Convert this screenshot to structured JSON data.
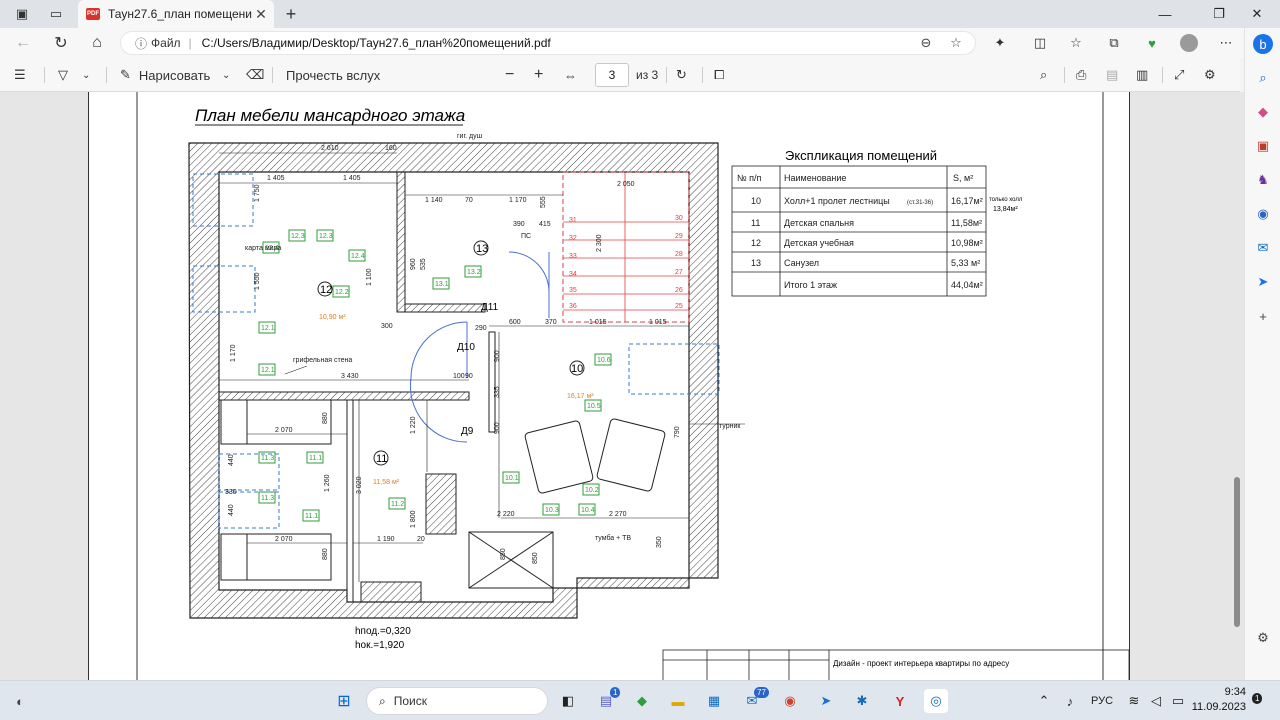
{
  "browser": {
    "tab_title": "Таун27.6_план помещений.pdf",
    "pdf_badge": "PDF",
    "address": {
      "info_label": "Файл",
      "separator": "|",
      "url": "C:/Users/Владимир/Desktop/Таун27.6_план%20помещений.pdf"
    }
  },
  "pdf_toolbar": {
    "draw_label": "Нарисовать",
    "read_aloud_label": "Прочесть вслух",
    "page_current": "3",
    "page_total": "из 3"
  },
  "plan": {
    "title": "План мебели мансардного этажа",
    "hpod": "hпод.=0,320",
    "hok": "hок.=1,920",
    "stamp_text": "Дизайн - проект интерьера квартиры по адресу",
    "labels": {
      "gig_dush": "гиг. душ",
      "karta_mira": "карта мира",
      "grifel": "грифельная стена",
      "ps": "ПС",
      "turnik": "турник",
      "tumba": "тумба + ТВ"
    },
    "rooms": [
      {
        "num": "12",
        "area": "10,90 м²"
      },
      {
        "num": "13",
        "area": ""
      },
      {
        "num": "10",
        "area": "16,17 м²"
      },
      {
        "num": "11",
        "area": "11,58 м²"
      }
    ],
    "doors": [
      "Д11",
      "Д10",
      "Д9"
    ],
    "dims": [
      "2 610",
      "160",
      "1 405",
      "1 405",
      "1 140",
      "70",
      "1 170",
      "2 050",
      "2 300",
      "3 430",
      "600",
      "370",
      "1 015",
      "1 015",
      "2 070",
      "880",
      "2 070",
      "880",
      "1 260",
      "3 020",
      "1 190",
      "1 800",
      "1 220",
      "2 220",
      "2 270",
      "900",
      "900",
      "335",
      "790",
      "350",
      "290",
      "300",
      "390",
      "415",
      "100",
      "1 100",
      "1 170",
      "1 550",
      "1 750",
      "850",
      "330",
      "440",
      "440",
      "20",
      "90",
      "850",
      "555",
      "960",
      "535"
    ],
    "tags": [
      "12.4",
      "12.3",
      "12.3",
      "12.4",
      "12.2",
      "12.1",
      "12.1",
      "13.1",
      "13.2",
      "11.3",
      "11.1",
      "11.3",
      "11.1",
      "11.2",
      "10.6",
      "10.5",
      "10.1",
      "10.2",
      "10.3",
      "10.4"
    ],
    "stair_steps": [
      "30",
      "29",
      "28",
      "27",
      "26",
      "25",
      "31",
      "32",
      "33",
      "34",
      "35",
      "36"
    ]
  },
  "explication": {
    "title": "Экспликация помещений",
    "headers": [
      "№ п/п",
      "Наименование",
      "S, м²"
    ],
    "rows": [
      {
        "num": "10",
        "name": "Холл+1 пролет лестницы",
        "note": "(ст.31-36)",
        "area": "16,17м²"
      },
      {
        "num": "11",
        "name": "Детская спальня",
        "note": "",
        "area": "11,58м²"
      },
      {
        "num": "12",
        "name": "Детская учебная",
        "note": "",
        "area": "10,98м²"
      },
      {
        "num": "13",
        "name": "Санузел",
        "note": "",
        "area": "5,33 м²"
      },
      {
        "num": "",
        "name": "Итого 1 этаж",
        "note": "",
        "area": "44,04м²"
      }
    ],
    "side_note_1": "только холл",
    "side_note_2": "13,84м²"
  },
  "taskbar": {
    "search_label": "Поиск",
    "language": "РУС",
    "time": "9:34",
    "date": "11.09.2023",
    "badge_teams": "1",
    "badge_mail": "77",
    "badge_notif": "1"
  },
  "colors": {
    "accent": "#2a64c9",
    "tag_green": "#2e9e3a",
    "stair_red": "#e04040",
    "area_orange": "#e08020",
    "door_blue": "#4a6fd6"
  }
}
